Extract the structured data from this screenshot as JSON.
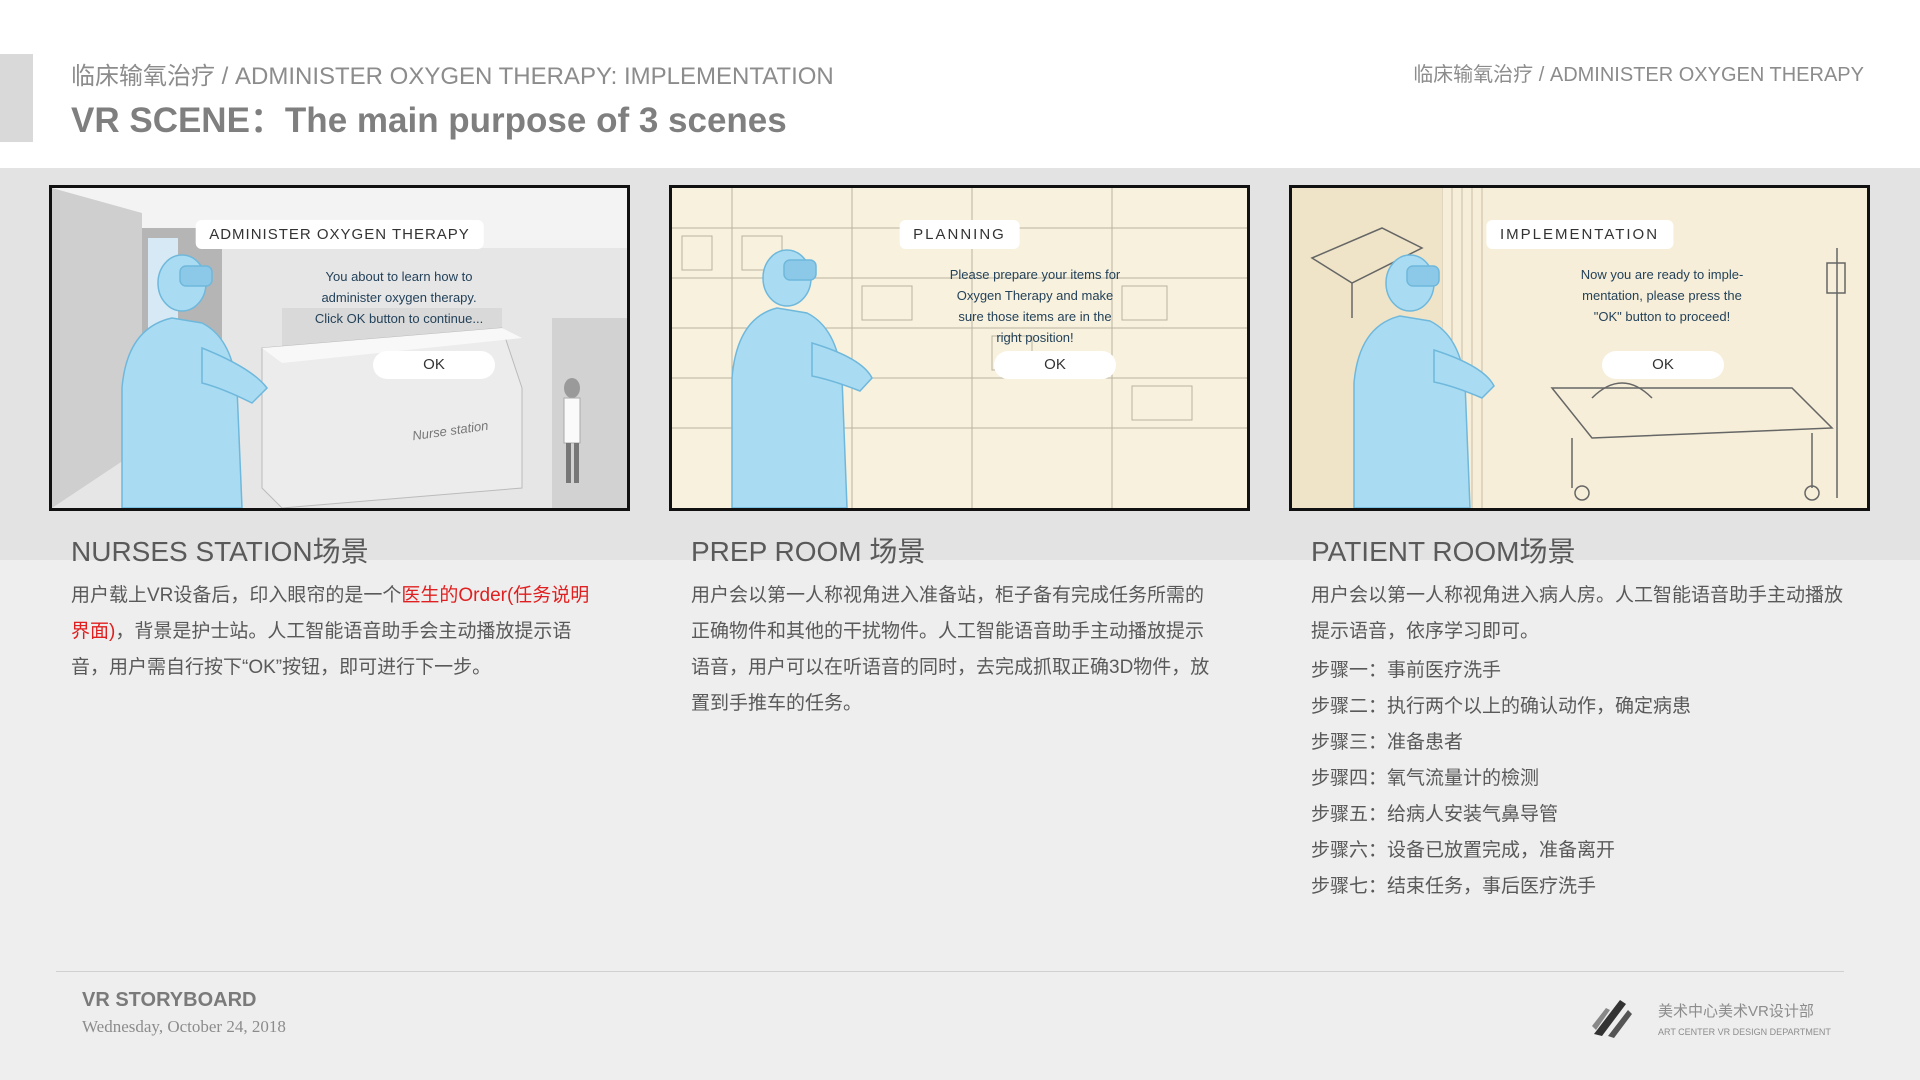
{
  "header": {
    "subtitle": "临床输氧治疗 / ADMINISTER  OXYGEN THERAPY: IMPLEMENTATION",
    "title": "VR SCENE：The main purpose of 3 scenes",
    "right_label": "临床输氧治疗 / ADMINISTER  OXYGEN THERAPY"
  },
  "scenes": [
    {
      "dialog_title": "ADMINISTER  OXYGEN THERAPY",
      "dialog_lines": [
        "You about to learn how to",
        "administer oxygen therapy.",
        "Click OK button to continue..."
      ],
      "ok": "OK",
      "sign": "Nurse station",
      "label": "NURSES STATION场景",
      "desc_part1": "用户载上VR设备后，印入眼帘的是一个",
      "desc_highlight": "医生的Order(任务说明界面)",
      "desc_part2": "，背景是护士站。人工智能语音助手会主动播放提示语音，用户需自行按下“OK”按钮，即可进行下一步。"
    },
    {
      "dialog_title": "PLANNING",
      "dialog_lines": [
        "Please prepare your items for",
        "Oxygen Therapy and make",
        "sure those items are in the",
        "right position!"
      ],
      "ok": "OK",
      "label": "PREP ROOM 场景",
      "desc": "用户会以第一人称视角进入准备站，柜子备有完成任务所需的正确物件和其他的干扰物件。人工智能语音助手主动播放提示语音，用户可以在听语音的同时，去完成抓取正确3D物件，放置到手推车的任务。"
    },
    {
      "dialog_title": "IMPLEMENTATION",
      "dialog_lines": [
        "Now you are ready to imple-",
        "mentation, please press the",
        "\"OK\" button to proceed!"
      ],
      "ok": "OK",
      "label": "PATIENT ROOM场景",
      "desc": "用户会以第一人称视角进入病人房。人工智能语音助手主动播放提示语音，依序学习即可。",
      "steps": [
        "步骤一：事前医疗洗手",
        "步骤二：执行两个以上的确认动作，确定病患",
        "步骤三：准备患者",
        "步骤四：氧气流量计的檢测",
        "步骤五：给病人安装气鼻导管",
        "步骤六：设备已放置完成，准备离开",
        "步骤七：结束任务，事后医疗洗手"
      ]
    }
  ],
  "footer": {
    "title": "VR STORYBOARD",
    "date": "Wednesday, October 24, 2018",
    "logo_cn": "美术中心美术VR设计部",
    "logo_en": "ART CENTER VR DESIGN DEPARTMENT"
  },
  "colors": {
    "dialog_blue": "#8fcdf0",
    "figure_blue": "#a9dcf2",
    "highlight_red": "#e02020",
    "text_gray": "#595959"
  }
}
